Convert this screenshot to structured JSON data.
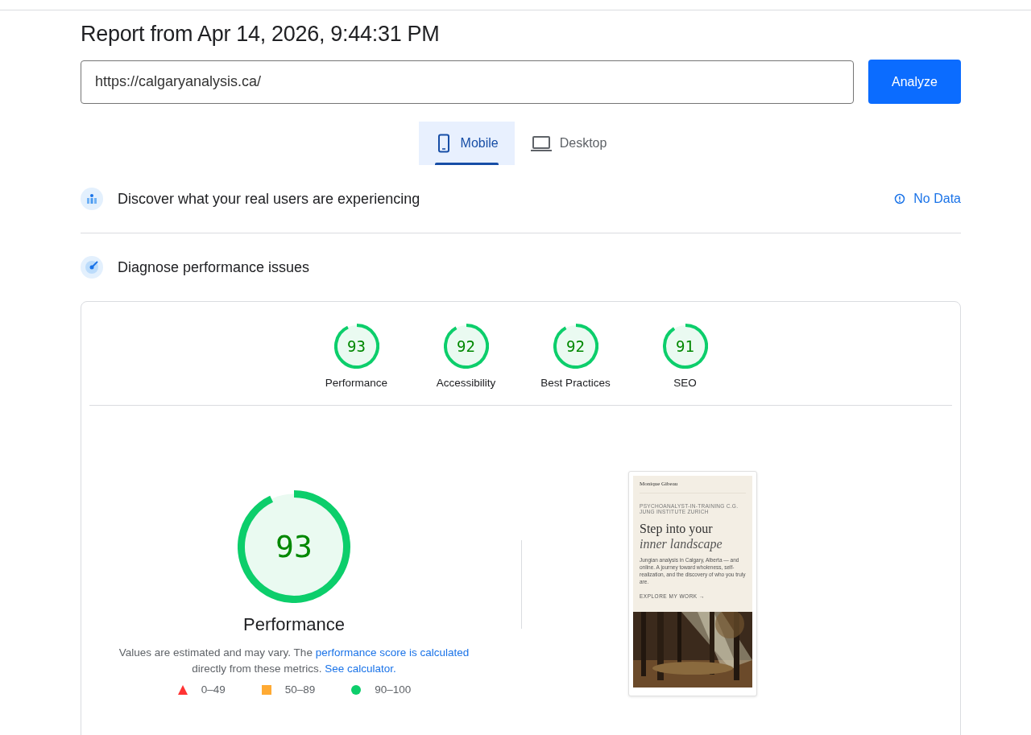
{
  "report_title": "Report from Apr 14, 2026, 9:44:31 PM",
  "url_field": {
    "value": "https://calgaryanalysis.ca/"
  },
  "analyze_button": "Analyze",
  "device_tabs": [
    {
      "label": "Mobile",
      "kind": "phone",
      "selected": true
    },
    {
      "label": "Desktop",
      "kind": "laptop",
      "selected": false
    }
  ],
  "field_data": {
    "title": "Discover what your real users are experiencing",
    "status": "No Data"
  },
  "lab_data": {
    "title": "Diagnose performance issues"
  },
  "categories": [
    {
      "score": "93",
      "label": "Performance",
      "level": 0.93
    },
    {
      "score": "92",
      "label": "Accessibility",
      "level": 0.92
    },
    {
      "score": "92",
      "label": "Best Practices",
      "level": 0.92
    },
    {
      "score": "91",
      "label": "SEO",
      "level": 0.91
    }
  ],
  "main_gauge": {
    "score": "93",
    "level": 0.93,
    "title": "Performance"
  },
  "note": [
    {
      "kind": "text",
      "text": "Values are estimated and may vary. The "
    },
    {
      "kind": "link",
      "text": "performance score is calculated"
    },
    {
      "kind": "text",
      "text": " directly from these metrics. "
    },
    {
      "kind": "link",
      "text": "See calculator."
    }
  ],
  "legend": [
    {
      "kind": "triangle",
      "label": "0–49",
      "color": "#ff3333"
    },
    {
      "kind": "square",
      "label": "50–89",
      "color": "#ffaa33"
    },
    {
      "kind": "circle",
      "label": "90–100",
      "color": "#0cce6b"
    }
  ],
  "screenshot": {
    "site_name": "Monique Gibeau",
    "eyebrow": "PSYCHOANALYST-IN-TRAINING   C.G. JUNG INSTITUTE ZURICH",
    "headline": "Step into your",
    "headline_italic": "inner landscape",
    "intro": "Jungian analysis in Calgary, Alberta — and online. A journey toward wholeness, self-realization, and the discovery of who you truly are.",
    "cta": "EXPLORE MY WORK →"
  }
}
